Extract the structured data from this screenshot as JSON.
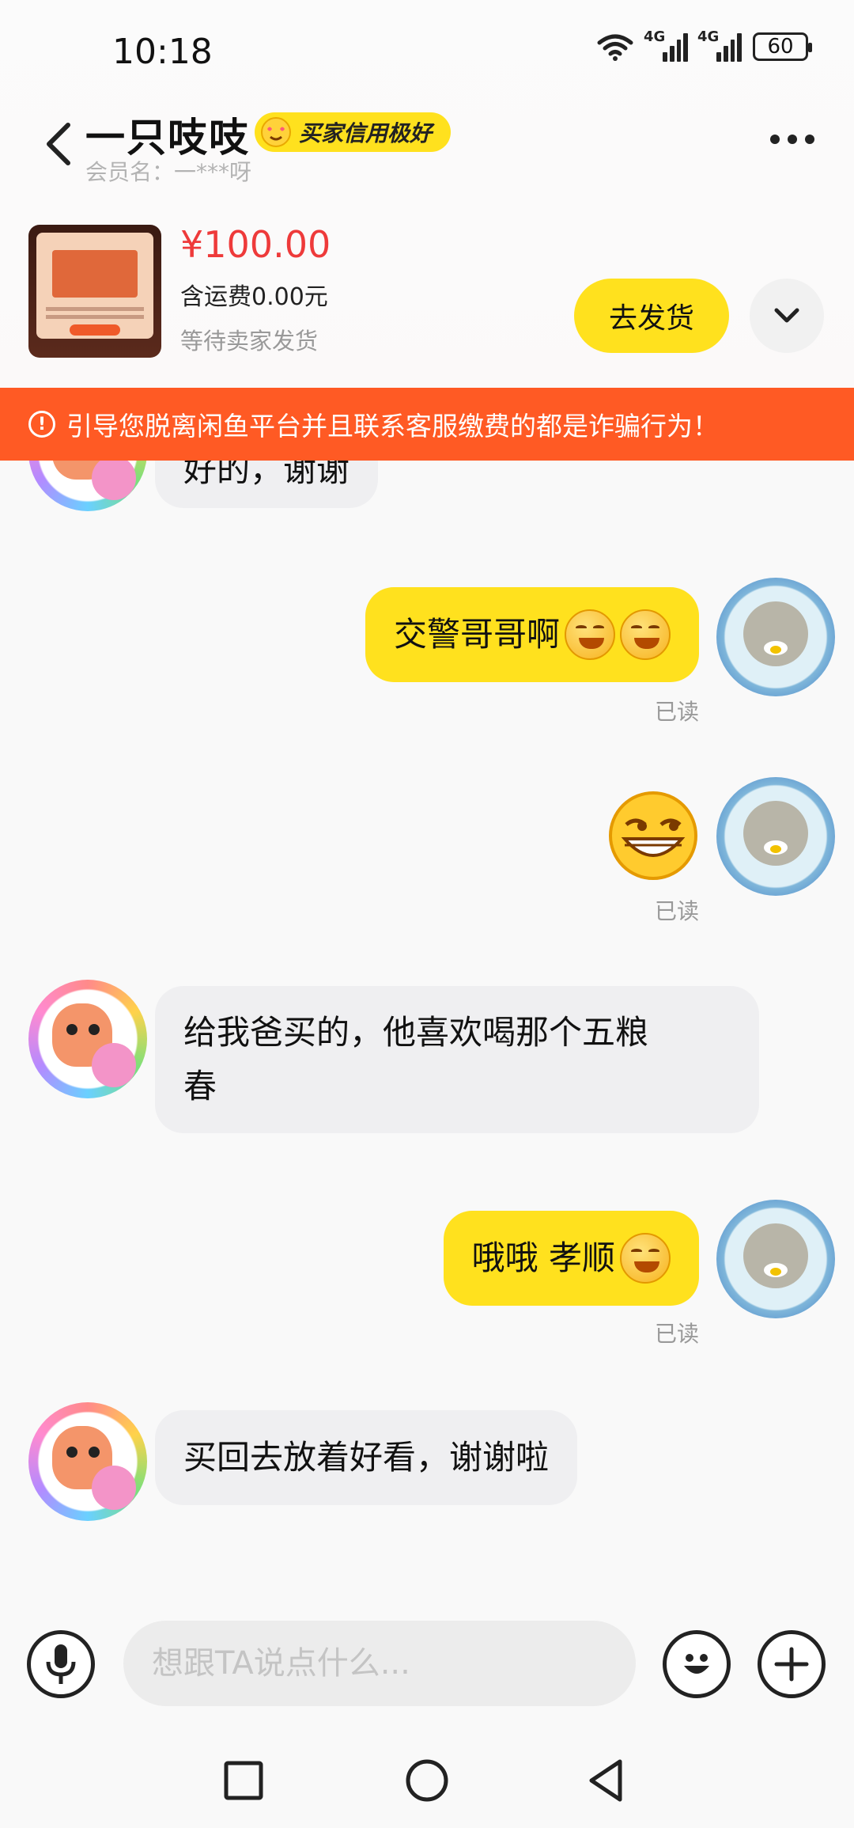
{
  "status_bar": {
    "time": "10:18",
    "network_1": "4G",
    "network_2": "4G",
    "battery": "60"
  },
  "header": {
    "title": "一只吱吱",
    "badge": "买家信用极好",
    "member_label": "会员名：",
    "member_name": "一***呀"
  },
  "order": {
    "price": "¥100.00",
    "shipping": "含运费0.00元",
    "status": "等待卖家发货",
    "ship_button": "去发货"
  },
  "warning": {
    "text": "引导您脱离闲鱼平台并且联系客服缴费的都是诈骗行为！"
  },
  "messages": [
    {
      "side": "in",
      "text": "好的，谢谢"
    },
    {
      "side": "out",
      "text": "交警哥哥啊",
      "read": "已读"
    },
    {
      "side": "out",
      "sticker": "grin-emoji",
      "read": "已读"
    },
    {
      "side": "in",
      "text_line1": "给我爸买的，他喜欢喝那个五粮",
      "text_line2": "春"
    },
    {
      "side": "out",
      "text": "哦哦 孝顺",
      "read": "已读"
    },
    {
      "side": "in",
      "text": "买回去放着好看，谢谢啦"
    }
  ],
  "input": {
    "placeholder": "想跟TA说点什么..."
  },
  "colors": {
    "accent_yellow": "#ffe11e",
    "price_red": "#ee3a3a",
    "warning_orange": "#ff5a24"
  }
}
